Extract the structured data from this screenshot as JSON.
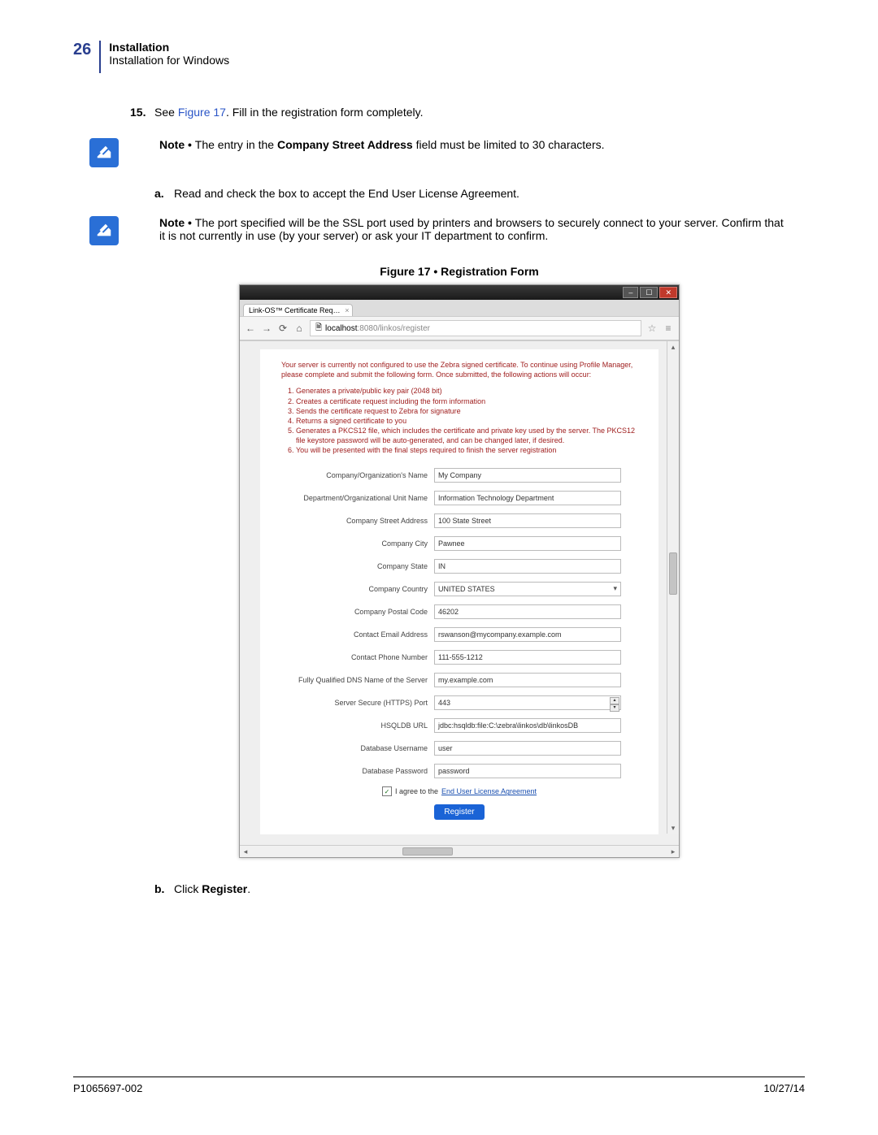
{
  "page_number": "26",
  "section_title": "Installation",
  "section_subtitle": "Installation for Windows",
  "step15": {
    "num": "15.",
    "prefix": "See ",
    "figref": "Figure 17",
    "suffix": ". Fill in the registration form completely."
  },
  "note1": {
    "lead": "Note • ",
    "t1": "The entry in the ",
    "bold": "Company Street Address",
    "t2": " field must be limited to 30 characters."
  },
  "sub_a": {
    "letter": "a.",
    "text": "Read and check the box to accept the End User License Agreement."
  },
  "note2": {
    "lead": "Note • ",
    "text": "The port specified will be the SSL port used by printers and browsers to securely connect to your server. Confirm that it is not currently in use (by your server) or ask your IT department to confirm."
  },
  "figure_caption": "Figure 17 • Registration Form",
  "browser": {
    "tab_title": "Link-OS™ Certificate Req…",
    "url_host": "localhost",
    "url_path": ":8080/linkos/register"
  },
  "form_intro": "Your server is currently not configured to use the Zebra signed certificate. To continue using Profile Manager, please complete and submit the following form. Once submitted, the following actions will occur:",
  "form_steps": [
    "Generates a private/public key pair (2048 bit)",
    "Creates a certificate request including the form information",
    "Sends the certificate request to Zebra for signature",
    "Returns a signed certificate to you",
    "Generates a PKCS12 file, which includes the certificate and private key used by the server. The PKCS12 file keystore password will be auto-generated, and can be changed later, if desired.",
    "You will be presented with the final steps required to finish the server registration"
  ],
  "fields": {
    "org": {
      "label": "Company/Organization's Name",
      "value": "My Company"
    },
    "dept": {
      "label": "Department/Organizational Unit Name",
      "value": "Information Technology Department"
    },
    "street": {
      "label": "Company Street Address",
      "value": "100 State Street"
    },
    "city": {
      "label": "Company City",
      "value": "Pawnee"
    },
    "state": {
      "label": "Company State",
      "value": "IN"
    },
    "country": {
      "label": "Company Country",
      "value": "UNITED STATES"
    },
    "postal": {
      "label": "Company Postal Code",
      "value": "46202"
    },
    "email": {
      "label": "Contact Email Address",
      "value": "rswanson@mycompany.example.com"
    },
    "phone": {
      "label": "Contact Phone Number",
      "value": "111-555-1212"
    },
    "fqdn": {
      "label": "Fully Qualified DNS Name of the Server",
      "value": "my.example.com"
    },
    "port": {
      "label": "Server Secure (HTTPS) Port",
      "value": "443"
    },
    "hsqldb": {
      "label": "HSQLDB URL",
      "value": "jdbc:hsqldb:file:C:\\zebra\\linkos\\db\\linkosDB"
    },
    "dbuser": {
      "label": "Database Username",
      "value": "user"
    },
    "dbpass": {
      "label": "Database Password",
      "value": "password"
    }
  },
  "eula": {
    "prefix": "I agree to the ",
    "link": "End User License Agreement"
  },
  "register_label": "Register",
  "sub_b": {
    "letter": "b.",
    "prefix": "Click ",
    "bold": "Register",
    "suffix": "."
  },
  "footer_left": "P1065697-002",
  "footer_right": "10/27/14"
}
